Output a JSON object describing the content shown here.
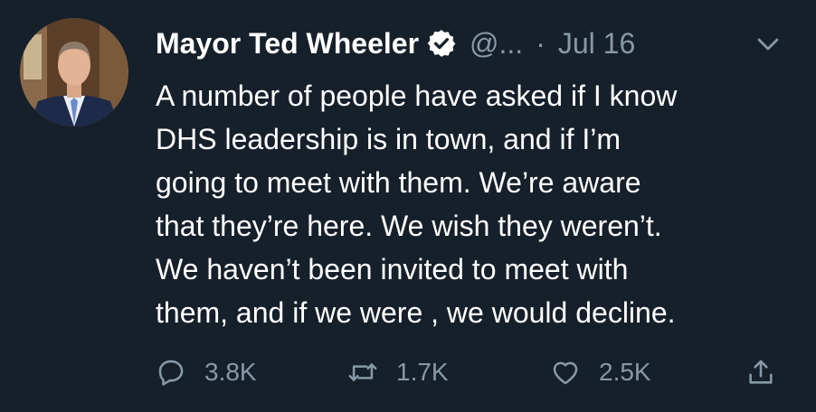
{
  "tweet": {
    "author_name": "Mayor Ted Wheeler",
    "handle": "@...",
    "separator": "·",
    "date": "Jul 16",
    "text_lines": [
      "A number of people have asked if I know",
      "DHS leadership is in town, and if I’m",
      "going to meet with them. We’re aware",
      "that they’re here. We wish they weren’t.",
      "We haven’t been invited to meet with",
      "them, and if we were , we would decline."
    ]
  },
  "actions": {
    "replies": "3.8K",
    "retweets": "1.7K",
    "likes": "2.5K"
  },
  "icons": {
    "verified": "verified-badge-icon",
    "caret": "chevron-down-icon",
    "reply": "reply-icon",
    "retweet": "retweet-icon",
    "like": "heart-icon",
    "share": "share-icon"
  },
  "colors": {
    "background": "#15202b",
    "text": "#ffffff",
    "muted": "#8899a6"
  }
}
